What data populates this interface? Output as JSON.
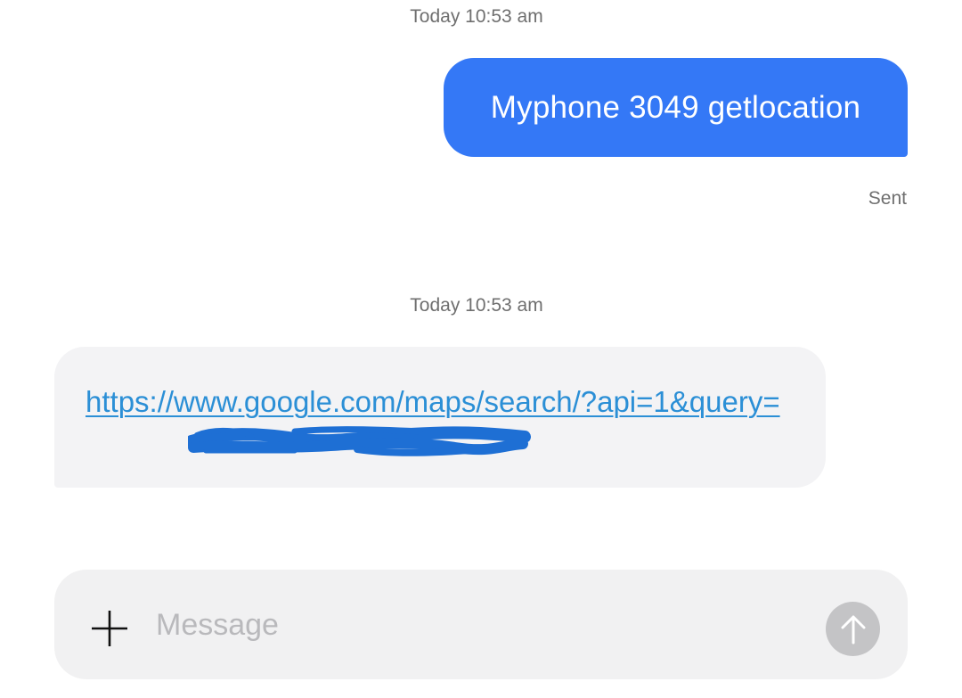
{
  "conversation": {
    "messages": [
      {
        "direction": "outgoing",
        "timestamp": "Today 10:53 am",
        "text": "Myphone 3049 getlocation",
        "status": "Sent"
      },
      {
        "direction": "incoming",
        "timestamp": "Today 10:53 am",
        "link_text": "https://www.google.com/maps/search/?api=1&query=",
        "redacted": true
      }
    ]
  },
  "composer": {
    "placeholder": "Message",
    "value": "",
    "add_icon": "plus-icon",
    "send_icon": "arrow-up-icon"
  },
  "colors": {
    "outgoing_bubble": "#3478f6",
    "incoming_bubble": "#f3f3f5",
    "link": "#2b8fd6",
    "redaction_scribble": "#1e6fd4",
    "send_button_disabled": "#c4c4c6"
  }
}
